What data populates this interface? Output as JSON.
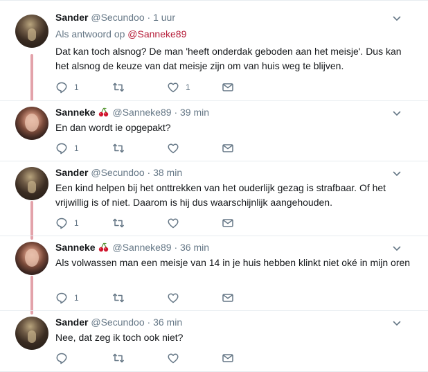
{
  "tweets": [
    {
      "name": "Sander",
      "handle": "@Secundoo",
      "time": "· 1 uur",
      "reply_prefix": "Als antwoord op ",
      "reply_mention": "@Sanneke89",
      "text": "Dat kan toch alsnog? De man 'heeft onderdak geboden aan het meisje'. Dus kan het alsnog de keuze van dat meisje zijn om van huis weg te blijven.",
      "reply_count": "1",
      "retweet_count": "",
      "like_count": "1"
    },
    {
      "name": "Sanneke",
      "handle": "@Sanneke89",
      "time": "· 39 min",
      "text": "En dan wordt ie opgepakt?",
      "reply_count": "1",
      "retweet_count": "",
      "like_count": ""
    },
    {
      "name": "Sander",
      "handle": "@Secundoo",
      "time": "· 38 min",
      "text": "Een kind helpen bij het onttrekken van het ouderlijk gezag is strafbaar. Of het vrijwillig is of niet. Daarom is hij dus waarschijnlijk aangehouden.",
      "reply_count": "1",
      "retweet_count": "",
      "like_count": ""
    },
    {
      "name": "Sanneke",
      "handle": "@Sanneke89",
      "time": "· 36 min",
      "text": "Als volwassen man een meisje van 14 in je huis hebben klinkt niet oké in mijn oren",
      "reply_count": "1",
      "retweet_count": "",
      "like_count": ""
    },
    {
      "name": "Sander",
      "handle": "@Secundoo",
      "time": "· 36 min",
      "text": "Nee, dat zeg ik toch ook niet?",
      "reply_count": "",
      "retweet_count": "",
      "like_count": ""
    }
  ],
  "icons": {
    "reply": "reply-icon",
    "retweet": "retweet-icon",
    "like": "heart-icon",
    "dm": "envelope-icon",
    "more": "chevron-down-icon",
    "emoji": "cherries-emoji"
  },
  "colors": {
    "thread_line": "#e3a2aa",
    "mention": "#b61e3a",
    "secondary_text": "#657786",
    "icon": "#657786",
    "divider": "#e6ecf0"
  }
}
